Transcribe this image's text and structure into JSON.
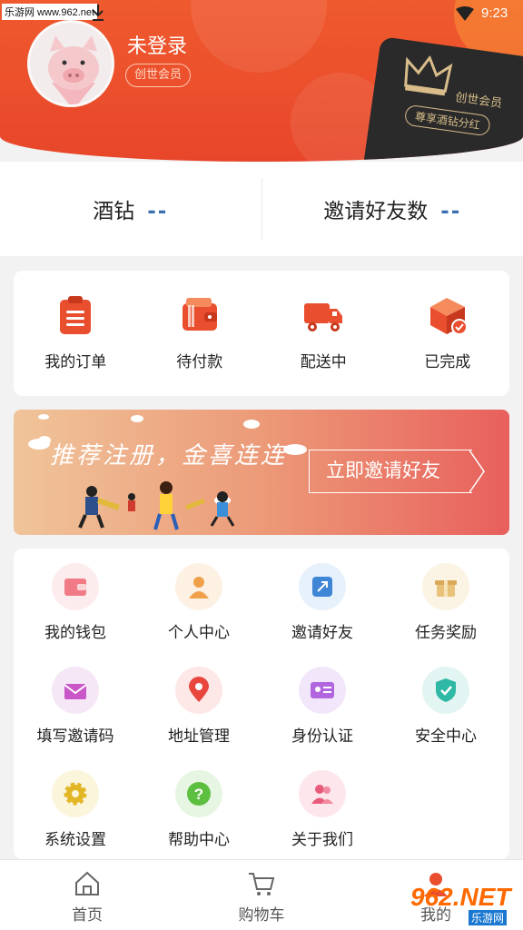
{
  "status_bar": {
    "watermark": "乐游网 www.962.net",
    "time": "9:23"
  },
  "profile": {
    "username": "未登录",
    "member_badge": "创世会员",
    "vip_card": {
      "title": "创世会员",
      "slogan": "尊享酒钻分红"
    }
  },
  "stats": [
    {
      "label": "酒钻",
      "value": "--"
    },
    {
      "label": "邀请好友数",
      "value": "--"
    }
  ],
  "orders": [
    {
      "label": "我的订单",
      "icon": "clipboard-icon"
    },
    {
      "label": "待付款",
      "icon": "wallet-icon"
    },
    {
      "label": "配送中",
      "icon": "truck-icon"
    },
    {
      "label": "已完成",
      "icon": "box-check-icon"
    }
  ],
  "banner": {
    "slogan": "推荐注册，金喜连连",
    "button": "立即邀请好友"
  },
  "services": [
    {
      "label": "我的钱包",
      "icon": "wallet-icon"
    },
    {
      "label": "个人中心",
      "icon": "person-icon"
    },
    {
      "label": "邀请好友",
      "icon": "share-icon"
    },
    {
      "label": "任务奖励",
      "icon": "gift-icon"
    },
    {
      "label": "填写邀请码",
      "icon": "envelope-icon"
    },
    {
      "label": "地址管理",
      "icon": "location-pin-icon"
    },
    {
      "label": "身份认证",
      "icon": "id-card-icon"
    },
    {
      "label": "安全中心",
      "icon": "shield-check-icon"
    },
    {
      "label": "系统设置",
      "icon": "gear-icon"
    },
    {
      "label": "帮助中心",
      "icon": "question-icon"
    },
    {
      "label": "关于我们",
      "icon": "users-icon"
    }
  ],
  "tabbar": [
    {
      "label": "首页",
      "icon": "home-icon"
    },
    {
      "label": "购物车",
      "icon": "cart-icon"
    },
    {
      "label": "我的",
      "icon": "profile-icon"
    }
  ],
  "site_watermark": {
    "text": "962.NET",
    "sub": "乐游网"
  },
  "colors": {
    "header": "#e8462a",
    "accent": "#e94e2e",
    "stat_value": "#3a6fb0"
  }
}
